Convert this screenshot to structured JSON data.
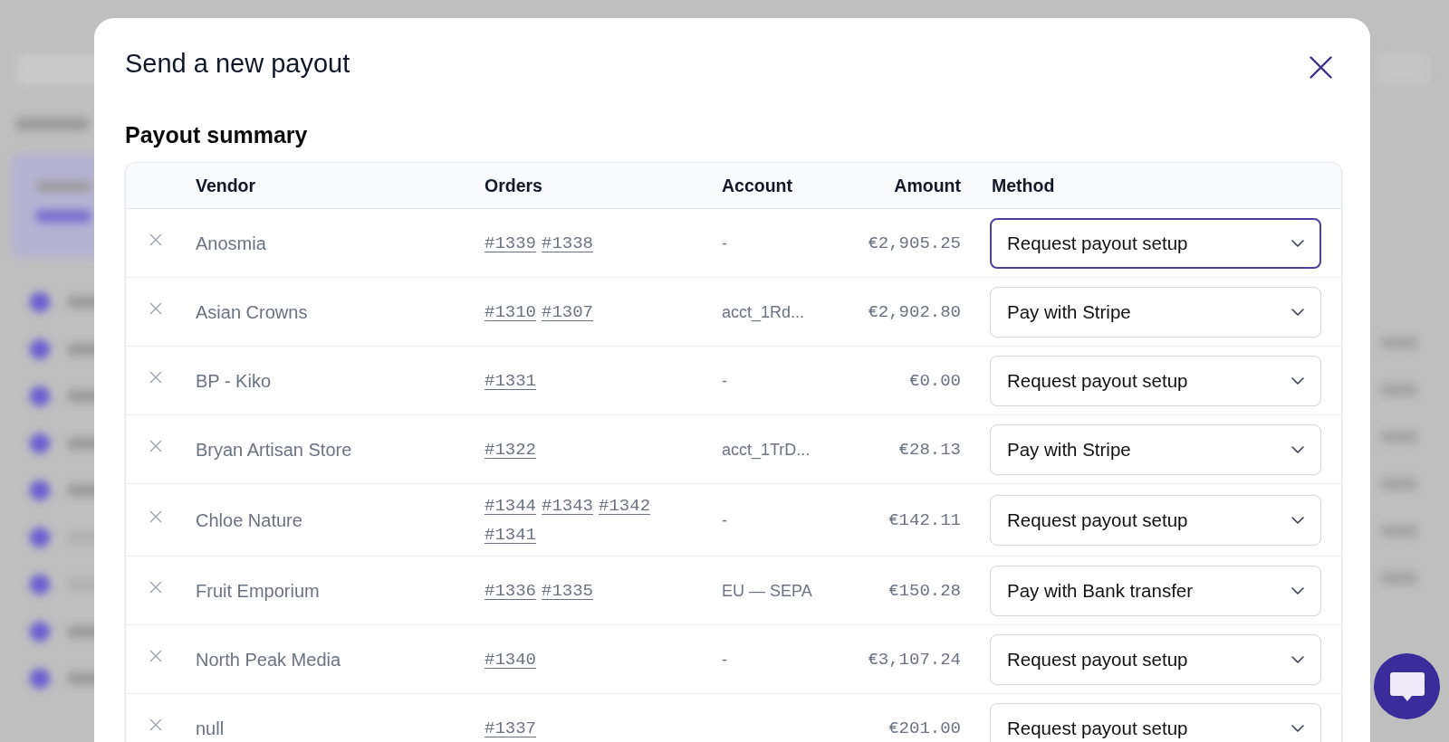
{
  "dialog": {
    "title": "Send a new payout"
  },
  "payout_summary": {
    "heading": "Payout summary",
    "columns": [
      "Vendor",
      "Orders",
      "Account",
      "Amount",
      "Method"
    ],
    "rows": [
      {
        "vendor": "Anosmia",
        "orders": [
          "#1339",
          "#1338"
        ],
        "account": "-",
        "amount": "€2,905.25",
        "method": "Request payout setup",
        "focused": true
      },
      {
        "vendor": "Asian Crowns",
        "orders": [
          "#1310",
          "#1307"
        ],
        "account": "acct_1Rd...",
        "amount": "€2,902.80",
        "method": "Pay with Stripe",
        "focused": false
      },
      {
        "vendor": "BP - Kiko",
        "orders": [
          "#1331"
        ],
        "account": "-",
        "amount": "€0.00",
        "method": "Request payout setup",
        "focused": false
      },
      {
        "vendor": "Bryan Artisan Store",
        "orders": [
          "#1322"
        ],
        "account": "acct_1TrD...",
        "amount": "€28.13",
        "method": "Pay with Stripe",
        "focused": false
      },
      {
        "vendor": "Chloe Nature",
        "orders": [
          "#1344",
          "#1343",
          "#1342",
          "#1341"
        ],
        "account": "-",
        "amount": "€142.11",
        "method": "Request payout setup",
        "focused": false
      },
      {
        "vendor": "Fruit Emporium",
        "orders": [
          "#1336",
          "#1335"
        ],
        "account": "EU — SEPA",
        "amount": "€150.28",
        "method": "Pay with Bank transfer",
        "focused": false
      },
      {
        "vendor": "North Peak Media",
        "orders": [
          "#1340"
        ],
        "account": "-",
        "amount": "€3,107.24",
        "method": "Request payout setup",
        "focused": false
      },
      {
        "vendor": "null",
        "orders": [
          "#1337"
        ],
        "amount": "€201.00",
        "method": "Request payout setup",
        "focused": false
      }
    ]
  }
}
